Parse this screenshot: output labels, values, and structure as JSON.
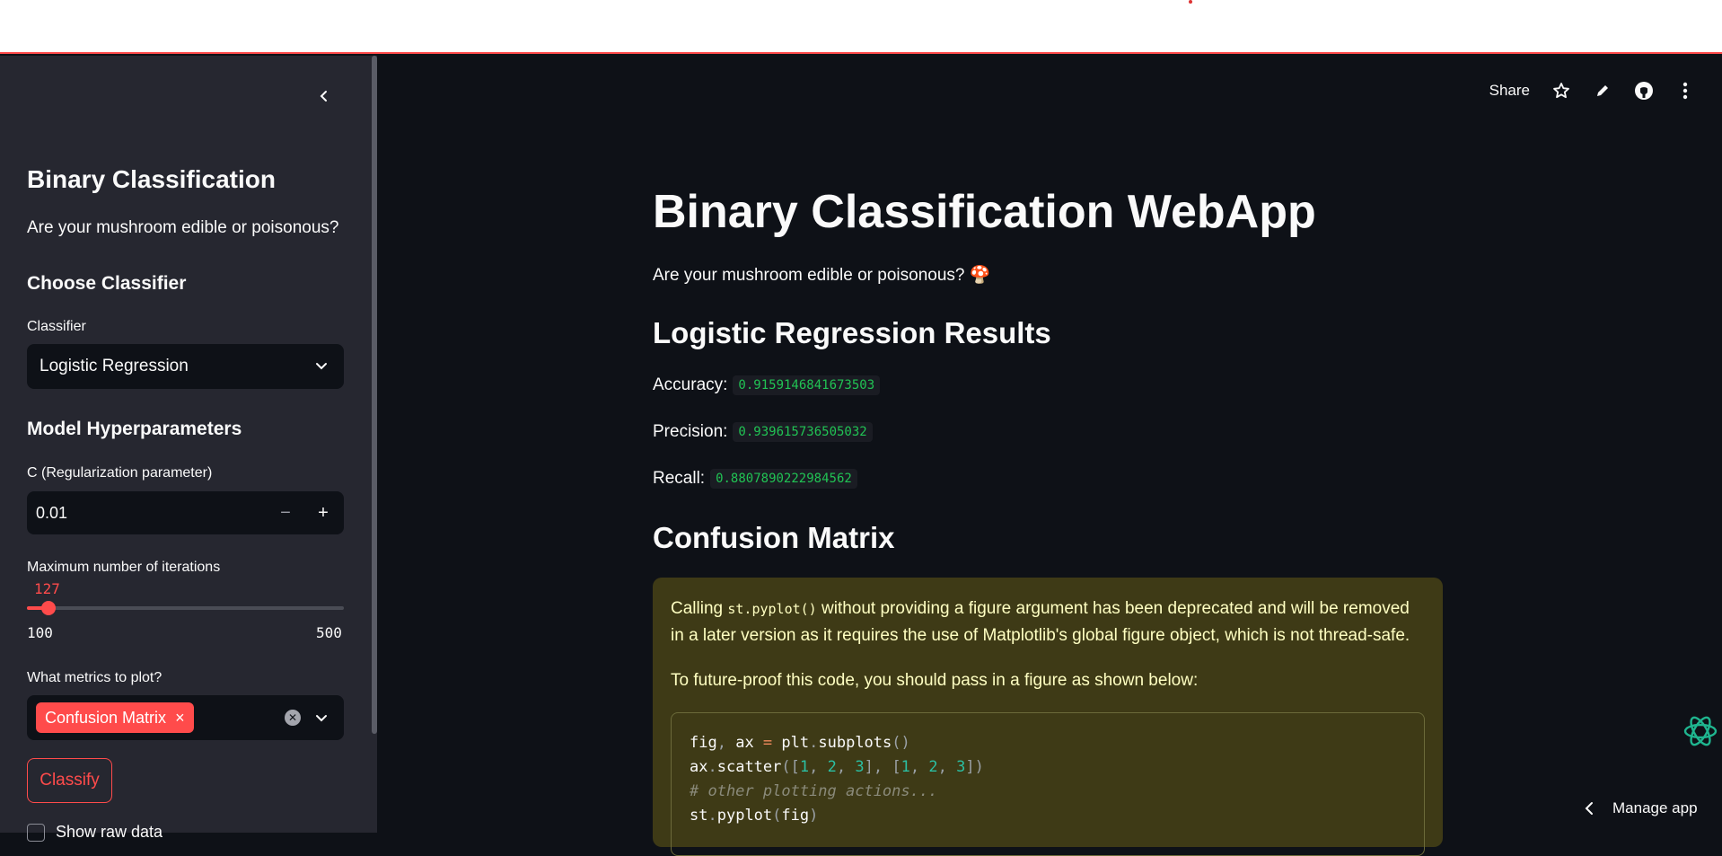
{
  "sidebar": {
    "title": "Binary Classification",
    "subtitle": "Are your mushroom edible or poisonous?",
    "choose_classifier_heading": "Choose Classifier",
    "classifier_label": "Classifier",
    "classifier_value": "Logistic Regression",
    "hyperparams_heading": "Model Hyperparameters",
    "c_label": "C (Regularization parameter)",
    "c_value": "0.01",
    "c_minus": "−",
    "c_plus": "+",
    "iter_label": "Maximum number of iterations",
    "iter_value": "127",
    "iter_min": "100",
    "iter_max": "500",
    "iter_fraction": 0.0675,
    "metrics_label": "What metrics to plot?",
    "metrics_tags": [
      "Confusion Matrix"
    ],
    "tag_remove": "×",
    "classify_button": "Classify",
    "show_raw_label": "Show raw data"
  },
  "toolbar": {
    "share_label": "Share"
  },
  "main": {
    "title": "Binary Classification WebApp",
    "subtitle": "Are your mushroom edible or poisonous? 🍄",
    "results_heading": "Logistic Regression Results",
    "metrics": [
      {
        "label": "Accuracy:",
        "value": "0.9159146841673503"
      },
      {
        "label": "Precision:",
        "value": "0.939615736505032"
      },
      {
        "label": "Recall:",
        "value": "0.8807890222984562"
      }
    ],
    "confusion_heading": "Confusion Matrix",
    "warning": {
      "text_before": "Calling ",
      "code": "st.pyplot()",
      "text_after": " without providing a figure argument has been deprecated and will be removed in a later version as it requires the use of Matplotlib's global figure object, which is not thread-safe.",
      "future_text": "To future-proof this code, you should pass in a figure as shown below:"
    }
  },
  "footer": {
    "manage_app": "Manage app"
  },
  "colors": {
    "accent": "#ff4b4b",
    "background": "#0e1117",
    "sidebar": "#262730",
    "metric_code": "#21c354",
    "warning_bg": "#3e3a16"
  }
}
